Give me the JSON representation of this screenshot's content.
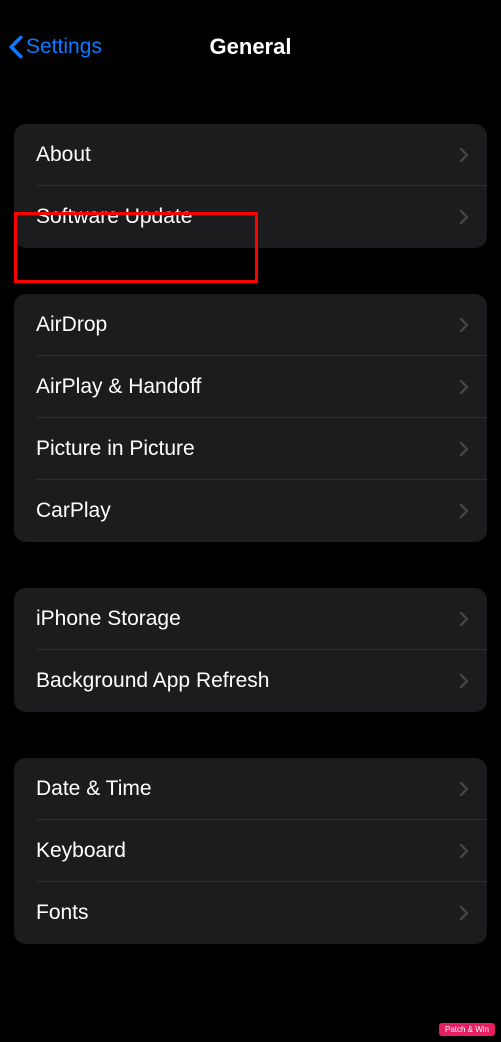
{
  "header": {
    "back_label": "Settings",
    "title": "General"
  },
  "groups": [
    {
      "items": [
        {
          "label": "About",
          "name": "row-about"
        },
        {
          "label": "Software Update",
          "name": "row-software-update"
        }
      ]
    },
    {
      "items": [
        {
          "label": "AirDrop",
          "name": "row-airdrop"
        },
        {
          "label": "AirPlay & Handoff",
          "name": "row-airplay-handoff"
        },
        {
          "label": "Picture in Picture",
          "name": "row-picture-in-picture"
        },
        {
          "label": "CarPlay",
          "name": "row-carplay"
        }
      ]
    },
    {
      "items": [
        {
          "label": "iPhone Storage",
          "name": "row-iphone-storage"
        },
        {
          "label": "Background App Refresh",
          "name": "row-background-app-refresh"
        }
      ]
    },
    {
      "items": [
        {
          "label": "Date & Time",
          "name": "row-date-time"
        },
        {
          "label": "Keyboard",
          "name": "row-keyboard"
        },
        {
          "label": "Fonts",
          "name": "row-fonts"
        }
      ]
    }
  ],
  "watermark": "Patch & Win"
}
